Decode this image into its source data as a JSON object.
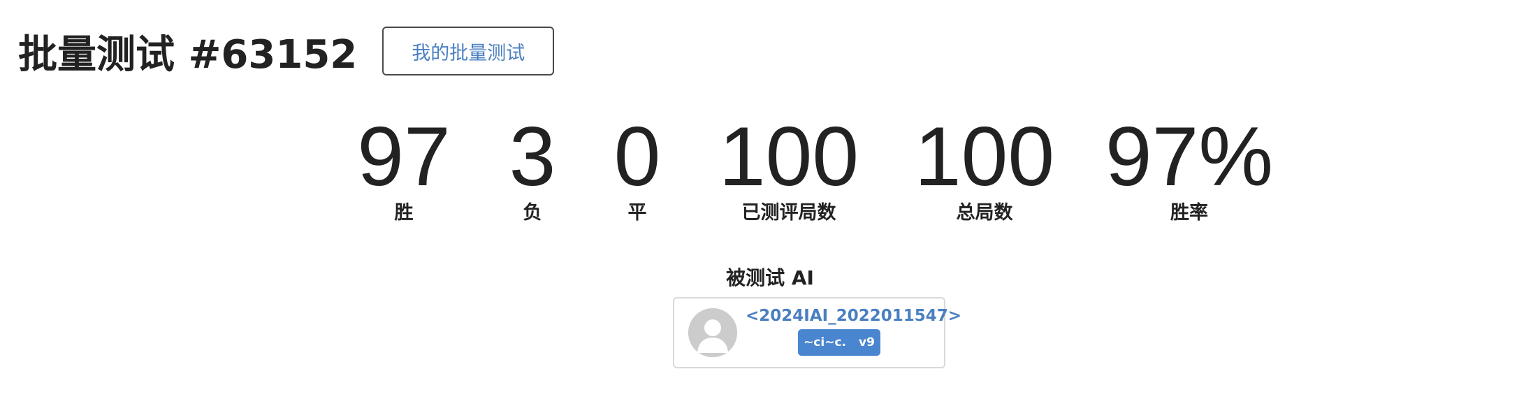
{
  "header": {
    "title": "批量测试 #63152",
    "my_batch_button": "我的批量测试"
  },
  "stats": [
    {
      "value": "97",
      "label": "胜"
    },
    {
      "value": "3",
      "label": "负"
    },
    {
      "value": "0",
      "label": "平"
    },
    {
      "value": "100",
      "label": "已测评局数"
    },
    {
      "value": "100",
      "label": "总局数"
    },
    {
      "value": "97%",
      "label": "胜率"
    }
  ],
  "tested_ai": {
    "section_title": "被测试 AI",
    "name": "<2024IAI_2022011547>",
    "badge_tag": "~ci~c.",
    "badge_version": "v9",
    "avatar_icon": "default-user-icon"
  },
  "colors": {
    "link": "#4a7fc1",
    "badge_bg": "#4a86cf",
    "text": "#222222"
  }
}
